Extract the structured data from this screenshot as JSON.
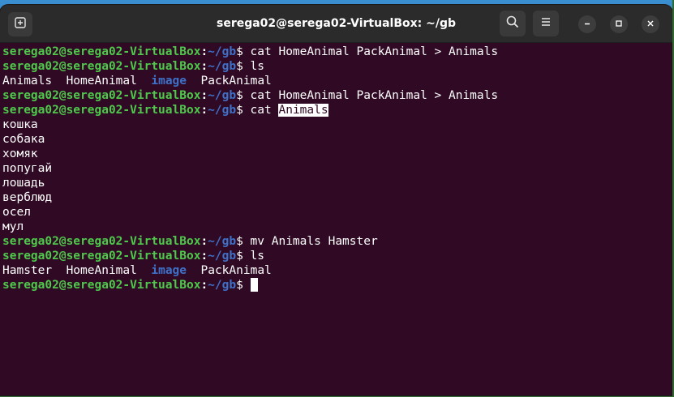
{
  "window": {
    "title": "serega02@serega02-VirtualBox: ~/gb"
  },
  "prompt": {
    "user_host": "serega02@serega02-VirtualBox",
    "colon": ":",
    "path": "~/gb",
    "dollar": "$"
  },
  "lines": [
    {
      "kind": "cmd",
      "text": " cat HomeAnimal PackAnimal > Animals"
    },
    {
      "kind": "cmd",
      "text": " ls"
    },
    {
      "kind": "ls",
      "items": [
        "Animals",
        "HomeAnimal",
        "image",
        "PackAnimal"
      ]
    },
    {
      "kind": "cmd",
      "text": " cat HomeAnimal PackAnimal > Animals"
    },
    {
      "kind": "cmd_sel",
      "text": " cat ",
      "selected": "Animals"
    },
    {
      "kind": "out",
      "text": "кошка"
    },
    {
      "kind": "out",
      "text": "собака"
    },
    {
      "kind": "out",
      "text": "хомяк"
    },
    {
      "kind": "out",
      "text": "попугай"
    },
    {
      "kind": "out",
      "text": "лошадь"
    },
    {
      "kind": "out",
      "text": "верблюд"
    },
    {
      "kind": "out",
      "text": "осел"
    },
    {
      "kind": "out",
      "text": "мул"
    },
    {
      "kind": "cmd",
      "text": " mv Animals Hamster"
    },
    {
      "kind": "cmd",
      "text": " ls"
    },
    {
      "kind": "ls",
      "items": [
        "Hamster",
        "HomeAnimal",
        "image",
        "PackAnimal"
      ]
    },
    {
      "kind": "cursor",
      "text": " "
    }
  ],
  "icons": {
    "new_tab": "new-tab-icon",
    "search": "search-icon",
    "menu": "hamburger-menu-icon",
    "minimize": "minimize-icon",
    "maximize": "maximize-icon",
    "close": "close-icon"
  },
  "colors": {
    "terminal_bg": "#300a24",
    "prompt_user": "#4ec94b",
    "prompt_path": "#3e71c9",
    "directory": "#3e71c9",
    "titlebar_bg": "#2b2b2b"
  }
}
